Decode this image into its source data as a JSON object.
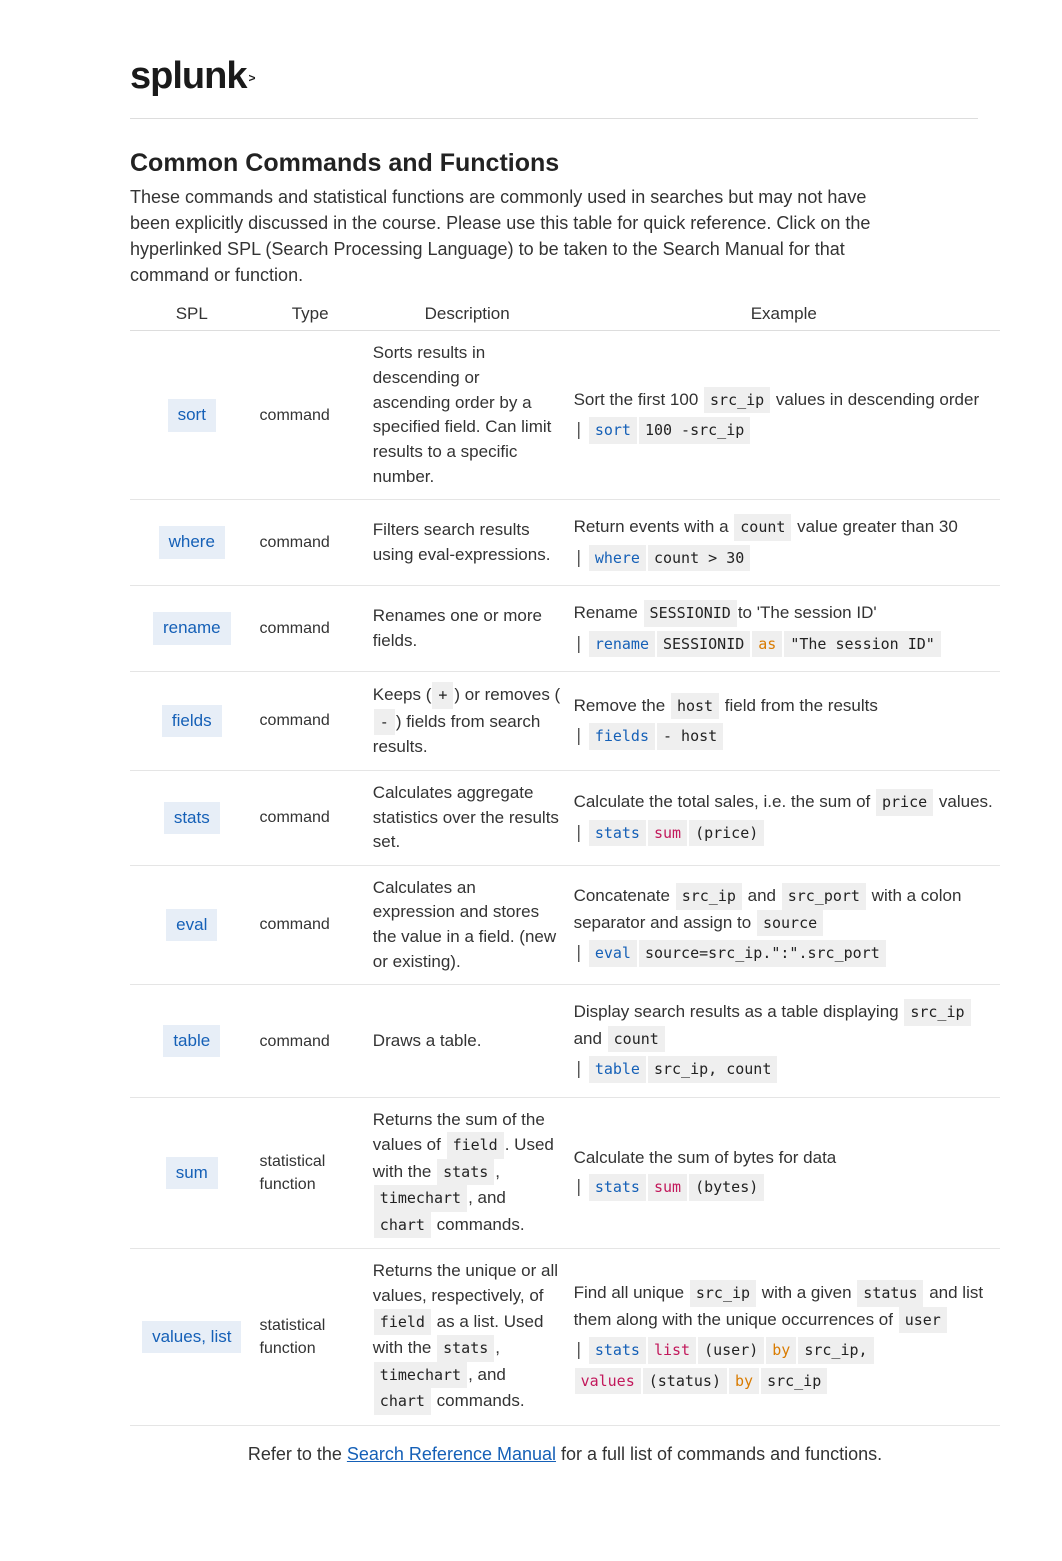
{
  "logo": "splunk",
  "logo_sup": ">",
  "title": "Common Commands and Functions",
  "intro": "These commands and statistical functions are commonly used in searches but may not have been explicitly discussed in the course. Please use this table for quick reference. Click on the hyperlinked SPL (Search Processing Language) to be taken to the Search Manual for that command or function.",
  "cols": {
    "spl": "SPL",
    "type": "Type",
    "desc": "Description",
    "example": "Example"
  },
  "rows": [
    {
      "spl": "sort",
      "type": "command",
      "desc": "Sorts results in descending or ascending order by a specified field. Can limit results to a specific number.",
      "ex_text_pre": "Sort the first 100 ",
      "ex_text_m1": "src_ip",
      "ex_text_post": " values in descending order",
      "ex_code": [
        {
          "t": "pipe",
          "v": "|"
        },
        {
          "t": "blue",
          "v": " sort "
        },
        {
          "t": "plain",
          "v": " 100 -src_ip"
        }
      ]
    },
    {
      "spl": "where",
      "type": "command",
      "desc": "Filters search results using eval-expressions.",
      "ex_text_pre": "Return events with a ",
      "ex_text_m1": "count",
      "ex_text_post": " value greater than 30",
      "ex_code": [
        {
          "t": "pipe",
          "v": "|"
        },
        {
          "t": "blue",
          "v": " where "
        },
        {
          "t": "plain",
          "v": " count > 30"
        }
      ]
    },
    {
      "spl": "rename",
      "type": "command",
      "desc": "Renames one or more fields.",
      "ex_text_pre": "Rename ",
      "ex_text_m1": "SESSIONID",
      "ex_text_post": "to 'The session ID'",
      "ex_code": [
        {
          "t": "pipe",
          "v": "|"
        },
        {
          "t": "blue",
          "v": " rename "
        },
        {
          "t": "plain",
          "v": " SESSIONID "
        },
        {
          "t": "orange",
          "v": "as"
        },
        {
          "t": "plain",
          "v": " \"The session ID\""
        }
      ]
    },
    {
      "spl": "fields",
      "type": "command",
      "desc_tokens": [
        {
          "t": "text",
          "v": "Keeps ("
        },
        {
          "t": "mono",
          "v": "+"
        },
        {
          "t": "text",
          "v": ") or removes ("
        },
        {
          "t": "mono",
          "v": "-"
        },
        {
          "t": "text",
          "v": ") fields from search results."
        }
      ],
      "ex_text_pre": "Remove the ",
      "ex_text_m1": "host",
      "ex_text_post": " field from the results",
      "ex_code": [
        {
          "t": "pipe",
          "v": "|"
        },
        {
          "t": "blue",
          "v": " fields "
        },
        {
          "t": "plain",
          "v": " - host"
        }
      ]
    },
    {
      "spl": "stats",
      "type": "command",
      "desc": "Calculates aggregate statistics over the results set.",
      "ex_text_pre": "Calculate the total sales, i.e. the sum of ",
      "ex_text_m1": "price",
      "ex_text_post": " values.",
      "ex_code": [
        {
          "t": "pipe",
          "v": "|"
        },
        {
          "t": "blue",
          "v": " stats "
        },
        {
          "t": "pink",
          "v": "sum"
        },
        {
          "t": "plain",
          "v": "(price)"
        }
      ]
    },
    {
      "spl": "eval",
      "type": "command",
      "desc": "Calculates an expression and stores the value in a field. (new or existing).",
      "ex_text_pre": "Concatenate ",
      "ex_text_m1": "src_ip",
      "ex_text_mid": " and ",
      "ex_text_m2": "src_port",
      "ex_text_post2": " with a colon separator and assign to ",
      "ex_text_m3": "source",
      "ex_code": [
        {
          "t": "pipe",
          "v": "|"
        },
        {
          "t": "blue",
          "v": " eval "
        },
        {
          "t": "plain",
          "v": " source=src_ip.\":\".src_port"
        }
      ]
    },
    {
      "spl": "table",
      "type": "command",
      "desc": "Draws a table.",
      "ex_text_pre": "Display search results as a table displaying ",
      "ex_text_m1": "src_ip",
      "ex_text_mid": " and ",
      "ex_text_m2": "count",
      "ex_code": [
        {
          "t": "pipe",
          "v": "|"
        },
        {
          "t": "blue",
          "v": " table "
        },
        {
          "t": "plain",
          "v": " src_ip, count"
        }
      ]
    },
    {
      "spl": "sum",
      "type": "statistical function",
      "desc_tokens": [
        {
          "t": "text",
          "v": "Returns the sum of the values of "
        },
        {
          "t": "mono",
          "v": "field"
        },
        {
          "t": "text",
          "v": ". Used with the "
        },
        {
          "t": "mono",
          "v": "stats"
        },
        {
          "t": "text",
          "v": ", "
        },
        {
          "t": "mono",
          "v": "timechart"
        },
        {
          "t": "text",
          "v": ", and "
        },
        {
          "t": "mono",
          "v": "chart"
        },
        {
          "t": "text",
          "v": " commands."
        }
      ],
      "ex_text_pre": "Calculate the sum of bytes for data",
      "ex_code": [
        {
          "t": "pipe",
          "v": "|"
        },
        {
          "t": "blue",
          "v": " stats "
        },
        {
          "t": "pink",
          "v": "sum"
        },
        {
          "t": "plain",
          "v": "(bytes)"
        }
      ]
    },
    {
      "spl": "values, list",
      "type": "statistical function",
      "desc_tokens": [
        {
          "t": "text",
          "v": "Returns the unique or all values, respectively, of "
        },
        {
          "t": "mono",
          "v": "field"
        },
        {
          "t": "text",
          "v": " as a list. Used with the "
        },
        {
          "t": "mono",
          "v": "stats"
        },
        {
          "t": "text",
          "v": ", "
        },
        {
          "t": "mono",
          "v": "timechart"
        },
        {
          "t": "text",
          "v": ", and "
        },
        {
          "t": "mono",
          "v": "chart"
        },
        {
          "t": "text",
          "v": " commands."
        }
      ],
      "ex_text_pre": "Find all unique ",
      "ex_text_m1": "src_ip",
      "ex_text_mid": " with a given ",
      "ex_text_m2": "status",
      "ex_text_post2": " and list them along with the unique occurrences of ",
      "ex_text_m3": "user",
      "ex_code": [
        {
          "t": "pipe",
          "v": "|"
        },
        {
          "t": "blue",
          "v": " stats "
        },
        {
          "t": "pink",
          "v": "list"
        },
        {
          "t": "plain",
          "v": "(user) "
        },
        {
          "t": "orange",
          "v": "by"
        },
        {
          "t": "plain",
          "v": " src_ip,"
        }
      ],
      "ex_code2": [
        {
          "t": "pink",
          "v": "values"
        },
        {
          "t": "plain",
          "v": "(status) "
        },
        {
          "t": "orange",
          "v": "by"
        },
        {
          "t": "plain",
          "v": " src_ip"
        }
      ]
    }
  ],
  "footer_pre": "Refer to the ",
  "footer_link": "Search Reference Manual",
  "footer_post": " for a full list of commands and functions."
}
